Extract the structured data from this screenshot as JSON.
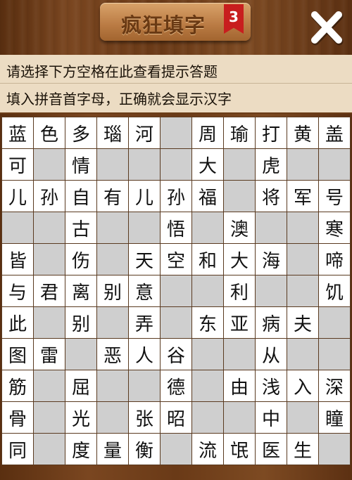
{
  "header": {
    "title": "疯狂填字",
    "level": "3",
    "close_icon": "close-icon"
  },
  "hint": {
    "line1": "请选择下方空格在此查看提示答题",
    "line2": "填入拼音首字母，正确就会显示汉字"
  },
  "grid": {
    "rows": [
      [
        "蓝",
        "色",
        "多",
        "瑙",
        "河",
        "",
        "周",
        "瑜",
        "打",
        "黄",
        "盖"
      ],
      [
        "可",
        "",
        "情",
        "",
        "",
        "",
        "大",
        "",
        "虎",
        "",
        ""
      ],
      [
        "儿",
        "孙",
        "自",
        "有",
        "儿",
        "孙",
        "福",
        "",
        "将",
        "军",
        "号"
      ],
      [
        "",
        "",
        "古",
        "",
        "",
        "悟",
        "",
        "澳",
        "",
        "",
        "寒"
      ],
      [
        "皆",
        "",
        "伤",
        "",
        "天",
        "空",
        "和",
        "大",
        "海",
        "",
        "啼"
      ],
      [
        "与",
        "君",
        "离",
        "别",
        "意",
        "",
        "",
        "利",
        "",
        "",
        "饥"
      ],
      [
        "此",
        "",
        "别",
        "",
        "弄",
        "",
        "东",
        "亚",
        "病",
        "夫",
        ""
      ],
      [
        "图",
        "雷",
        "",
        "恶",
        "人",
        "谷",
        "",
        "",
        "从",
        "",
        ""
      ],
      [
        "筋",
        "",
        "屈",
        "",
        "",
        "德",
        "",
        "由",
        "浅",
        "入",
        "深"
      ],
      [
        "骨",
        "",
        "光",
        "",
        "张",
        "昭",
        "",
        "",
        "中",
        "",
        "瞳"
      ],
      [
        "同",
        "",
        "度",
        "量",
        "衡",
        "",
        "流",
        "氓",
        "医",
        "生",
        ""
      ]
    ]
  }
}
